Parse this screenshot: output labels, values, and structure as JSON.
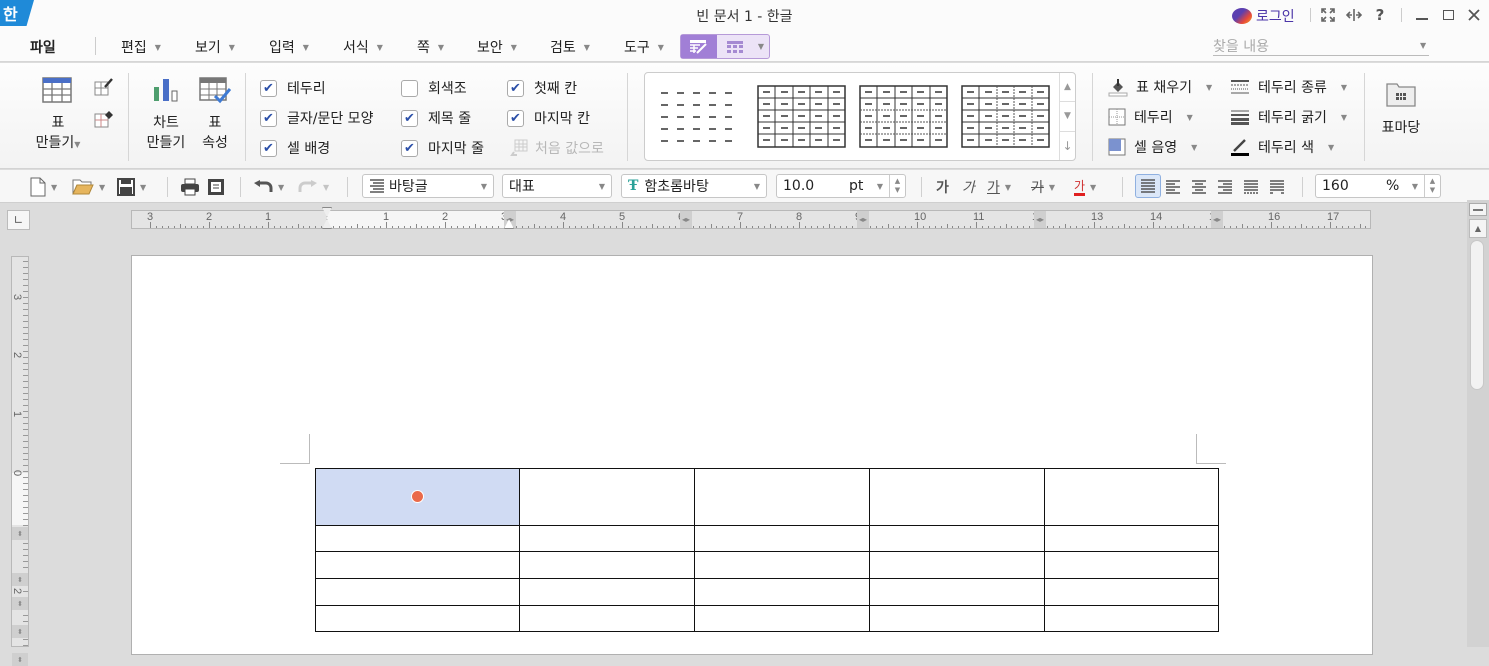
{
  "app": {
    "logo_text": "한",
    "window_title": "빈 문서 1 - 한글",
    "login_label": "로그인",
    "title_buttons": [
      "fullscreen-icon",
      "split-icon",
      "help-icon",
      "minimize-icon",
      "maximize-icon",
      "close-icon"
    ],
    "help_glyph": "?"
  },
  "menu": {
    "file": "파일",
    "items": [
      {
        "label": "편집"
      },
      {
        "label": "보기"
      },
      {
        "label": "입력"
      },
      {
        "label": "서식"
      },
      {
        "label": "쪽"
      },
      {
        "label": "보안"
      },
      {
        "label": "검토"
      },
      {
        "label": "도구"
      }
    ],
    "context_tabs": [
      "table-design",
      "table-layout"
    ],
    "search_placeholder": "찾을 내용"
  },
  "ribbon": {
    "make_table": {
      "line1": "표",
      "line2": "만들기"
    },
    "make_chart": {
      "line1": "차트",
      "line2": "만들기"
    },
    "table_props": {
      "line1": "표",
      "line2": "속성"
    },
    "checkboxes": [
      {
        "label": "테두리",
        "checked": true
      },
      {
        "label": "글자/문단 모양",
        "checked": true
      },
      {
        "label": "셀 배경",
        "checked": true
      },
      {
        "label": "회색조",
        "checked": false
      },
      {
        "label": "제목 줄",
        "checked": true
      },
      {
        "label": "마지막 줄",
        "checked": true
      },
      {
        "label": "첫째 칸",
        "checked": true
      },
      {
        "label": "마지막 칸",
        "checked": true
      }
    ],
    "reset_label": "처음 값으로",
    "style_gallery_count": 4,
    "right_tools": [
      {
        "label": "표 채우기"
      },
      {
        "label": "테두리"
      },
      {
        "label": "셀 음영"
      },
      {
        "label": "테두리 종류"
      },
      {
        "label": "테두리 굵기"
      },
      {
        "label": "테두리 색"
      }
    ],
    "table_yard": "표마당"
  },
  "toolbar": {
    "style": "바탕글",
    "lang": "대표",
    "font": "함초롬바탕",
    "size": "10.0",
    "size_unit": "pt",
    "bold": "가",
    "italic": "가",
    "underline": "가",
    "strike": "가",
    "color": "가",
    "zoom": "160",
    "zoom_unit": "%",
    "font_color": "#e02020",
    "accent": "#a17fd6"
  },
  "ruler": {
    "h_labels": [
      "3",
      "2",
      "1",
      "",
      "1",
      "2",
      "3",
      "4",
      "5",
      "6",
      "7",
      "8",
      "9",
      "10",
      "11",
      "12",
      "13",
      "14",
      "15",
      "16",
      "17"
    ],
    "v_labels": [
      "3",
      "2",
      "1",
      "0",
      "1",
      "2"
    ]
  },
  "document": {
    "table": {
      "rows": 5,
      "cols": 5,
      "cells": [
        [
          "",
          "",
          "",
          "",
          ""
        ],
        [
          "",
          "",
          "",
          "",
          ""
        ],
        [
          "",
          "",
          "",
          "",
          ""
        ],
        [
          "",
          "",
          "",
          "",
          ""
        ],
        [
          "",
          "",
          "",
          "",
          ""
        ]
      ],
      "selected_cell_color": "#d0dbf3",
      "cursor_dot_color": "#ea6a4a"
    }
  }
}
